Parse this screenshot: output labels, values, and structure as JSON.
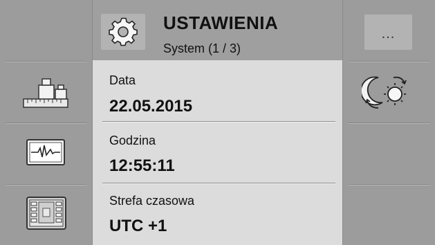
{
  "header": {
    "title": "USTAWIENIA",
    "subtitle": "System (1 / 3)",
    "icon": "gear-icon"
  },
  "settings": [
    {
      "label": "Data",
      "value": "22.05.2015"
    },
    {
      "label": "Godzina",
      "value": "12:55:11"
    },
    {
      "label": "Strefa czasowa",
      "value": "UTC +1"
    }
  ],
  "left_buttons": [
    {
      "icon": "scale-weights-icon"
    },
    {
      "icon": "waveform-monitor-icon"
    },
    {
      "icon": "screen-layout-icon"
    }
  ],
  "right_buttons": {
    "more_label": "...",
    "day_night_icon": "day-night-toggle-icon"
  },
  "colors": {
    "background": "#9c9c9c",
    "content": "#dcdcdc",
    "text": "#111111"
  }
}
